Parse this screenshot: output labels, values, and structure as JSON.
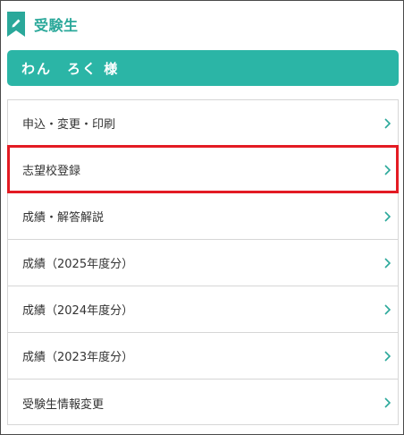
{
  "section": {
    "title": "受験生",
    "icon": "bookmark-pencil-icon"
  },
  "user": {
    "display_name": "わん　ろく 様"
  },
  "menu": {
    "items": [
      {
        "label": "申込・変更・印刷",
        "icon": "chevron-right-icon"
      },
      {
        "label": "志望校登録",
        "icon": "chevron-right-icon",
        "highlighted": true
      },
      {
        "label": "成績・解答解説",
        "icon": "chevron-right-icon"
      },
      {
        "label": "成績（2025年度分）",
        "icon": "chevron-right-icon"
      },
      {
        "label": "成績（2024年度分）",
        "icon": "chevron-right-icon"
      },
      {
        "label": "成績（2023年度分）",
        "icon": "chevron-right-icon"
      },
      {
        "label": "受験生情報変更",
        "icon": "chevron-right-icon"
      }
    ]
  },
  "colors": {
    "accent": "#2bb5a6",
    "title": "#2aa89a",
    "highlight": "#e31b23",
    "chevron": "#2aa89a"
  }
}
